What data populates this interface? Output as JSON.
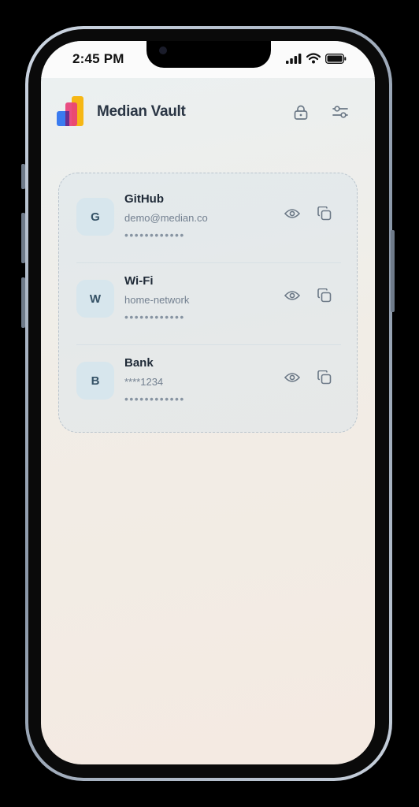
{
  "status": {
    "time": "2:45 PM",
    "icons": [
      "cellular-signal-icon",
      "wifi-icon",
      "battery-icon"
    ]
  },
  "header": {
    "title": "Median Vault",
    "actions": [
      "lock-icon",
      "settings-sliders-icon"
    ]
  },
  "colors": {
    "title": "#2a3544",
    "avatar_bg": "#d7e6ed",
    "avatar_text": "#355266",
    "icon": "#6a7785"
  },
  "entries": [
    {
      "initial": "G",
      "name": "GitHub",
      "detail": "demo@median.co",
      "secret": "••••••••••••"
    },
    {
      "initial": "W",
      "name": "Wi-Fi",
      "detail": "home-network",
      "secret": "••••••••••••"
    },
    {
      "initial": "B",
      "name": "Bank",
      "detail": "****1234",
      "secret": "••••••••••••"
    }
  ]
}
